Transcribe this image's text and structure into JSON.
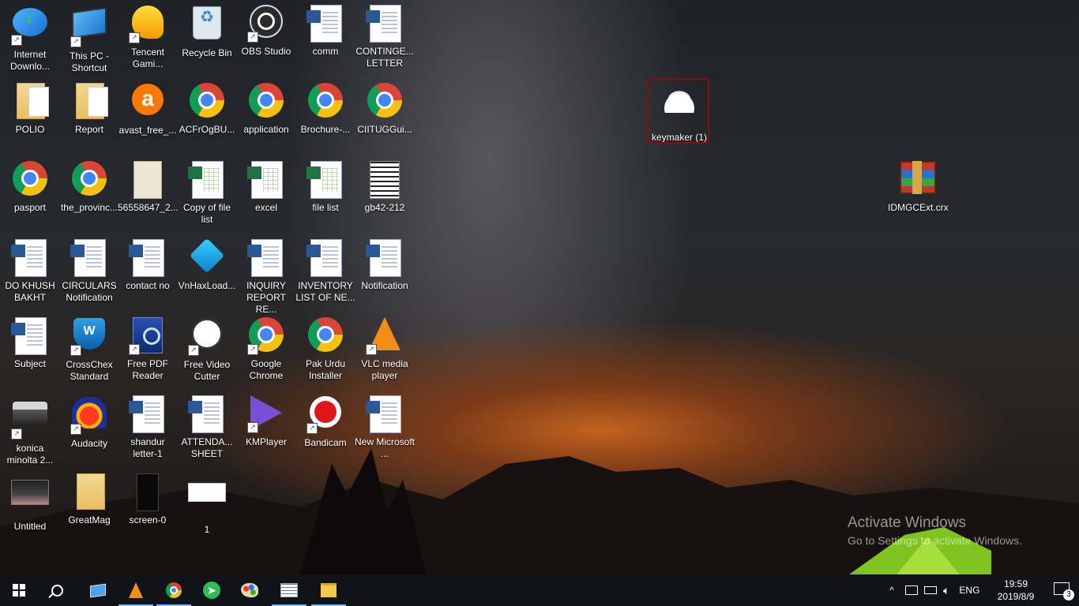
{
  "desktop": {
    "icons": [
      {
        "label": "Internet Downlo...",
        "icon": "idm-icon",
        "shortcut": true
      },
      {
        "label": "POLIO",
        "icon": "folder-icon",
        "shortcut": false
      },
      {
        "label": "pasport",
        "icon": "chrome-icon",
        "shortcut": false
      },
      {
        "label": "DO KHUSH BAKHT",
        "icon": "word-doc-icon",
        "shortcut": false
      },
      {
        "label": "Subject",
        "icon": "word-doc-icon",
        "shortcut": false
      },
      {
        "label": "konica minolta 2...",
        "icon": "printer-icon",
        "shortcut": true
      },
      {
        "label": "Untitled",
        "icon": "image-thumbnail-icon",
        "shortcut": false
      },
      {
        "label": "This PC - Shortcut",
        "icon": "this-pc-icon",
        "shortcut": true
      },
      {
        "label": "Report",
        "icon": "folder-icon",
        "shortcut": false
      },
      {
        "label": "the_provinc...",
        "icon": "chrome-icon",
        "shortcut": false
      },
      {
        "label": "CIRCULARS Notification",
        "icon": "word-doc-icon",
        "shortcut": false
      },
      {
        "label": "CrossChex Standard",
        "icon": "crosschex-icon",
        "shortcut": true
      },
      {
        "label": "Audacity",
        "icon": "audacity-icon",
        "shortcut": true
      },
      {
        "label": "GreatMag",
        "icon": "folder-chrome-icon",
        "shortcut": false
      },
      {
        "label": "Tencent Gami...",
        "icon": "tencent-icon",
        "shortcut": true
      },
      {
        "label": "avast_free_...",
        "icon": "avast-icon",
        "shortcut": false
      },
      {
        "label": "56558647_2...",
        "icon": "map-image-icon",
        "shortcut": false
      },
      {
        "label": "contact no",
        "icon": "word-doc-icon",
        "shortcut": false
      },
      {
        "label": "Free PDF Reader",
        "icon": "pdf-reader-icon",
        "shortcut": true
      },
      {
        "label": "shandur letter-1",
        "icon": "word-doc-icon",
        "shortcut": false
      },
      {
        "label": "screen-0",
        "icon": "screenshot-icon",
        "shortcut": false
      },
      {
        "label": "Recycle Bin",
        "icon": "recycle-bin-icon",
        "shortcut": false
      },
      {
        "label": "ACFrOgBU...",
        "icon": "chrome-icon",
        "shortcut": false
      },
      {
        "label": "Copy of file list",
        "icon": "excel-icon",
        "shortcut": false
      },
      {
        "label": "VnHaxLoad...",
        "icon": "vnhax-icon",
        "shortcut": false
      },
      {
        "label": "Free Video Cutter",
        "icon": "film-reel-icon",
        "shortcut": true
      },
      {
        "label": "ATTENDA... SHEET",
        "icon": "word-doc-icon",
        "shortcut": false
      },
      {
        "label": "1",
        "icon": "white-image-icon",
        "shortcut": false
      },
      {
        "label": "OBS Studio",
        "icon": "obs-icon",
        "shortcut": true
      },
      {
        "label": "application",
        "icon": "chrome-icon",
        "shortcut": false
      },
      {
        "label": "excel",
        "icon": "excel-icon",
        "shortcut": false
      },
      {
        "label": "INQUIRY REPORT RE...",
        "icon": "word-doc-icon",
        "shortcut": false
      },
      {
        "label": "Google Chrome",
        "icon": "chrome-icon",
        "shortcut": true
      },
      {
        "label": "KMPlayer",
        "icon": "kmplayer-icon",
        "shortcut": true
      },
      {
        "label": "comm",
        "icon": "word-doc-icon",
        "shortcut": false
      },
      {
        "label": "Brochure-...",
        "icon": "chrome-icon",
        "shortcut": false
      },
      {
        "label": "file list",
        "icon": "excel-icon",
        "shortcut": false
      },
      {
        "label": "INVENTORY LIST OF NE...",
        "icon": "word-doc-icon",
        "shortcut": false
      },
      {
        "label": "Pak Urdu Installer",
        "icon": "chrome-icon",
        "shortcut": false
      },
      {
        "label": "Bandicam",
        "icon": "bandicam-icon",
        "shortcut": true
      },
      {
        "label": "CONTINGE... LETTER",
        "icon": "word-doc-icon",
        "shortcut": false
      },
      {
        "label": "CIITUGGui...",
        "icon": "chrome-icon",
        "shortcut": false
      },
      {
        "label": "gb42-212",
        "icon": "scan-doc-icon",
        "shortcut": false
      },
      {
        "label": "Notification",
        "icon": "word-doc-icon",
        "shortcut": false
      },
      {
        "label": "VLC media player",
        "icon": "vlc-icon",
        "shortcut": true
      },
      {
        "label": "New Microsoft ...",
        "icon": "word-doc-icon",
        "shortcut": false
      },
      {
        "label": "keymaker (1)",
        "icon": "keymaker-hat-icon",
        "shortcut": false,
        "selected": true
      },
      {
        "label": "IDMGCExt.crx",
        "icon": "winrar-icon",
        "shortcut": false
      }
    ]
  },
  "watermark": {
    "title": "Activate Windows",
    "subtitle": "Go to Settings to activate Windows."
  },
  "taskbar": {
    "pinned": [
      {
        "name": "start-button",
        "icon": "windows-logo-icon"
      },
      {
        "name": "search-button",
        "icon": "search-icon"
      },
      {
        "name": "this-pc-taskbar",
        "icon": "this-pc-icon"
      },
      {
        "name": "vlc-taskbar",
        "icon": "vlc-icon"
      },
      {
        "name": "chrome-taskbar",
        "icon": "chrome-icon"
      },
      {
        "name": "send-taskbar",
        "icon": "paper-plane-icon"
      },
      {
        "name": "paint-taskbar",
        "icon": "paint-palette-icon"
      },
      {
        "name": "news-taskbar",
        "icon": "newspaper-icon"
      },
      {
        "name": "file-explorer-taskbar",
        "icon": "folder-icon"
      }
    ],
    "tray": {
      "chevron": "^",
      "language": "ENG",
      "time": "19:59",
      "date": "2019/8/9",
      "notification_count": "3"
    }
  }
}
